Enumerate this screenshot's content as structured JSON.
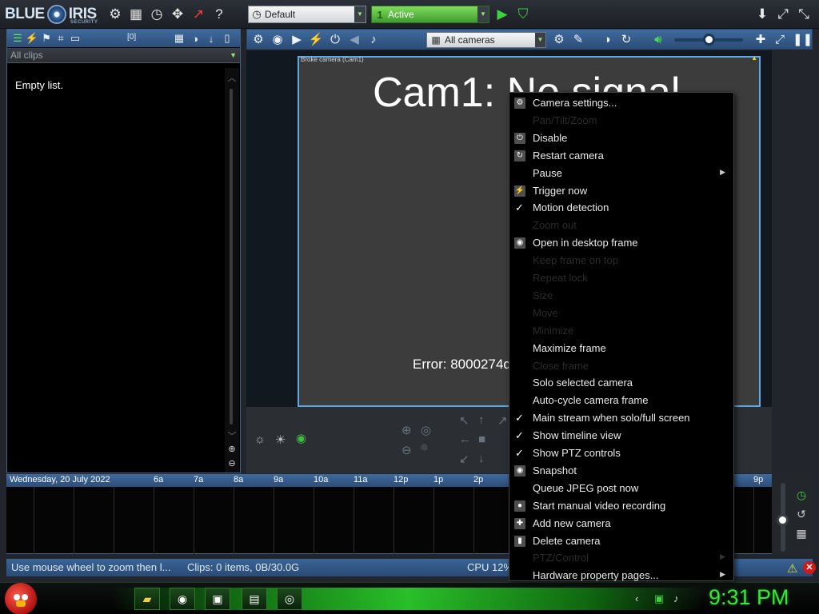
{
  "app": {
    "logo_left": "BLUE",
    "logo_right": "IRIS",
    "logo_sub": "SECURITY"
  },
  "topbar": {
    "profile_select": "Default",
    "schedule_select": "Active",
    "schedule_icon": "1"
  },
  "left_panel": {
    "clip_count": "[0]",
    "filter_select": "All clips",
    "empty_text": "Empty list."
  },
  "main_toolbar": {
    "cameras_select": "All cameras",
    "volume": 0.5
  },
  "camera": {
    "label": "Broke camera (Cam1)",
    "title": "Cam1: No signal",
    "error": "Error: 8000274d"
  },
  "timeline": {
    "date": "Wednesday, 20 July 2022",
    "ticks": [
      "6a",
      "7a",
      "8a",
      "9a",
      "10a",
      "11a",
      "12p",
      "1p",
      "2p",
      "9p"
    ]
  },
  "status": {
    "hint": "Use mouse wheel to zoom then l...",
    "clips": "Clips: 0 items, 0B/30.0G",
    "cpu": "CPU 12%"
  },
  "taskbar": {
    "clock": "9:31 PM"
  },
  "context_menu": {
    "items": [
      {
        "label": "Camera settings...",
        "enabled": true,
        "icon": "gear-icon"
      },
      {
        "label": "Pan/Tilt/Zoom",
        "enabled": false,
        "icon": ""
      },
      {
        "label": "Disable",
        "enabled": true,
        "icon": "power-icon"
      },
      {
        "label": "Restart camera",
        "enabled": true,
        "icon": "restart-icon"
      },
      {
        "label": "Pause",
        "enabled": true,
        "submenu": true
      },
      {
        "label": "Trigger now",
        "enabled": true,
        "icon": "trigger-icon"
      },
      {
        "label": "Motion detection",
        "enabled": true,
        "checked": true
      },
      {
        "label": "Zoom out",
        "enabled": false
      },
      {
        "label": "Open in desktop frame",
        "enabled": true,
        "icon": "desktop-frame-icon"
      },
      {
        "label": "Keep frame on top",
        "enabled": false
      },
      {
        "label": "Repeat lock",
        "enabled": false
      },
      {
        "label": "Size",
        "enabled": false
      },
      {
        "label": "Move",
        "enabled": false
      },
      {
        "label": "Minimize",
        "enabled": false
      },
      {
        "label": "Maximize frame",
        "enabled": true
      },
      {
        "label": "Close frame",
        "enabled": false
      },
      {
        "label": "Solo selected camera",
        "enabled": true
      },
      {
        "label": "Auto-cycle camera frame",
        "enabled": true
      },
      {
        "label": "Main stream when solo/full screen",
        "enabled": true,
        "checked": true
      },
      {
        "label": "Show timeline view",
        "enabled": true,
        "checked": true
      },
      {
        "label": "Show PTZ controls",
        "enabled": true,
        "checked": true
      },
      {
        "label": "Snapshot",
        "enabled": true,
        "icon": "camera-icon"
      },
      {
        "label": "Queue JPEG post now",
        "enabled": true
      },
      {
        "label": "Start manual video recording",
        "enabled": true,
        "icon": "record-icon"
      },
      {
        "label": "Add new camera",
        "enabled": true,
        "icon": "add-camera-icon"
      },
      {
        "label": "Delete camera",
        "enabled": true,
        "icon": "trash-icon"
      },
      {
        "label": "PTZ/Control",
        "enabled": false,
        "submenu": true
      },
      {
        "label": "Hardware property pages...",
        "enabled": true,
        "submenu": true
      }
    ]
  },
  "colors": {
    "accent_blue": "#3f6a9c",
    "active_green": "#7fdc5c",
    "frame_border": "#5ca9e3",
    "clock_green": "#39e639"
  }
}
